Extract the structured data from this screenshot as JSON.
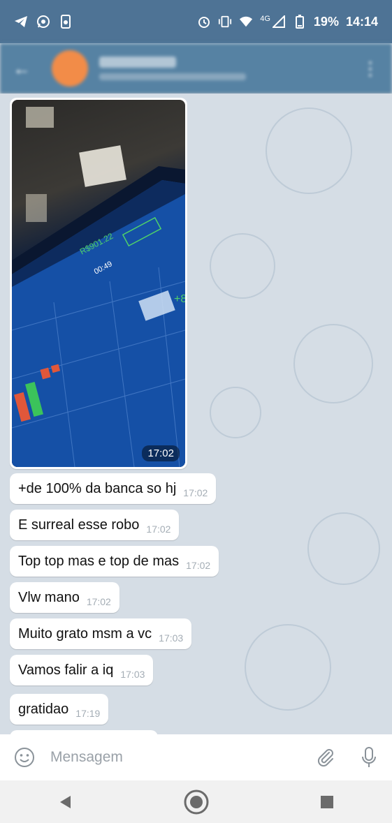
{
  "status_bar": {
    "network": "4G",
    "battery": "19%",
    "time": "14:14",
    "left_icons": [
      "telegram-icon",
      "whatsapp-icon",
      "phone-app-icon"
    ],
    "right_icons": [
      "alarm-icon",
      "vibrate-icon",
      "wifi-icon",
      "signal-icon",
      "battery-icon"
    ]
  },
  "photo_message": {
    "time": "17:02"
  },
  "messages": [
    {
      "text": "+de 100% da banca so hj",
      "time": "17:02"
    },
    {
      "text": "E surreal esse robo",
      "time": "17:02"
    },
    {
      "text": "Top top mas e top de mas",
      "time": "17:02"
    },
    {
      "text": "Vlw mano",
      "time": "17:02"
    },
    {
      "text": "Muito grato msm a vc",
      "time": "17:03"
    },
    {
      "text": "Vamos falir a iq",
      "time": "17:03"
    },
    {
      "text": "gratidao",
      "time": "17:19"
    }
  ],
  "composer": {
    "placeholder": "Mensagem",
    "emoji_icon": "emoji-icon",
    "attach_icon": "paperclip-icon",
    "mic_icon": "microphone-icon"
  },
  "colors": {
    "status_bar": "#4e7395",
    "header": "#5682a3",
    "chat_bg": "#d5dde5",
    "bubble": "#ffffff",
    "time_text": "#a4adb5",
    "avatar": "#f28c48"
  }
}
